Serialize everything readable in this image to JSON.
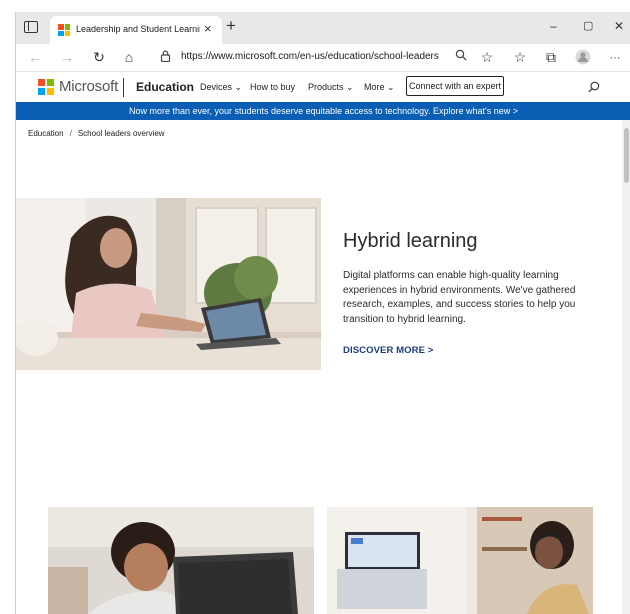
{
  "browser": {
    "tab": {
      "title": "Leadership and Student Learning",
      "close_glyph": "×",
      "favicon": "microsoft-favicon"
    },
    "new_tab_glyph": "+",
    "window_controls": {
      "minimize": "–",
      "maximize": "▢",
      "close": "✕"
    },
    "toolbar": {
      "back_icon": "←",
      "forward_icon": "→",
      "refresh_icon": "↻",
      "home_icon": "⌂",
      "lock_icon": "lock-icon",
      "url": "https://www.microsoft.com/en-us/education/school-leaders",
      "zoom_icon": "🔍",
      "favorite_icon": "☆",
      "favorites_icon": "☆",
      "collections_icon": "⧉",
      "more_icon": "···"
    }
  },
  "site": {
    "brand": "Microsoft",
    "section": "Education",
    "nav": [
      "Devices ⌄",
      "How to buy",
      "Products ⌄",
      "More ⌄"
    ],
    "cta": "Connect with an expert",
    "colors": {
      "logo": [
        "#f25022",
        "#7fba00",
        "#00a4ef",
        "#ffb900"
      ],
      "banner": "#0a5fb4",
      "link": "#1e3d7b"
    },
    "banner": "Now more than ever, your students deserve equitable access to technology. Explore what's new >"
  },
  "breadcrumb": {
    "root": "Education",
    "separator": "/",
    "current": "School leaders overview"
  },
  "hero": {
    "title": "Hybrid learning",
    "body": "Digital platforms can enable high-quality learning experiences in hybrid environments. We've gathered research, examples, and success stories to help you transition to hybrid learning.",
    "link": "DISCOVER MORE >"
  }
}
